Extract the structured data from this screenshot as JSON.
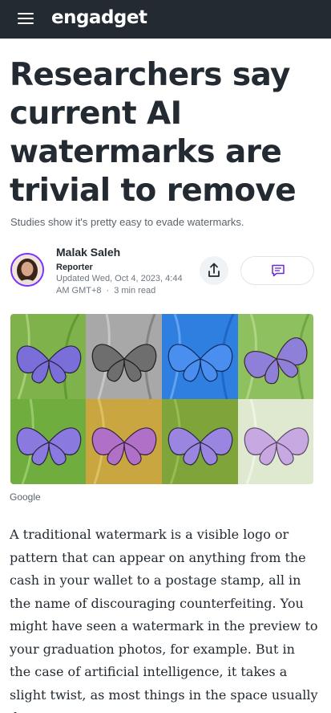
{
  "header": {
    "brand": "engadget",
    "menu_icon": "hamburger-menu-icon",
    "background": "#232a31"
  },
  "article": {
    "headline": "Researchers say current AI watermarks are trivial to remove",
    "subheadline": "Studies show it's pretty easy to evade watermarks.",
    "author": {
      "name": "Malak Saleh",
      "role": "Reporter",
      "updated": "Updated Wed, Oct 4, 2023, 4:44 AM GMT+8",
      "read_time": "3 min read",
      "separator": "·"
    },
    "actions": {
      "share_icon": "share-icon",
      "comment_icon": "comment-icon"
    },
    "hero_image": {
      "description_icon": "butterfly-grid-image",
      "caption": "Google"
    },
    "body": "A traditional watermark is a visible logo or pattern that can appear on anything from the cash in your wallet to a postage stamp, all in the name of discouraging counterfeiting. You might have seen a watermark in the preview to your graduation photos, for example. But in the case of artificial intelligence, it takes a slight twist, as most things in the space usually do."
  },
  "colors": {
    "accent": "#7d2eff",
    "text": "#232a31",
    "muted": "#5b636a"
  }
}
